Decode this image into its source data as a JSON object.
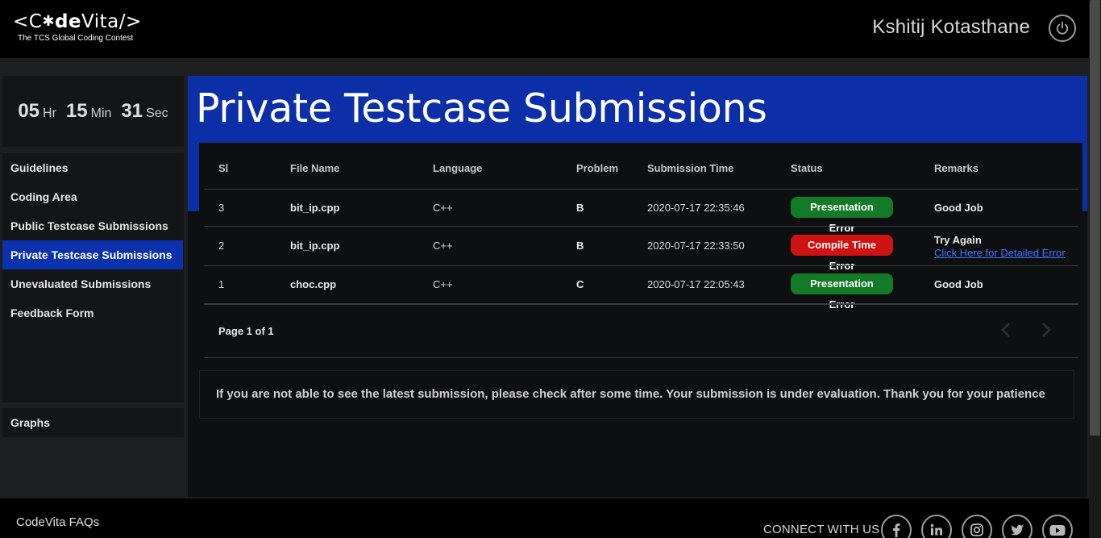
{
  "header": {
    "logo_prefix": "<C",
    "logo_star": "✱",
    "logo_de": "de",
    "logo_suffix": "Vita/>",
    "logo_tagline": "The TCS Global Coding Contest",
    "user_name": "Kshitij Kotasthane",
    "power_icon": "power-icon"
  },
  "timer": {
    "hours": "05",
    "hours_unit": "Hr",
    "minutes": "15",
    "minutes_unit": "Min",
    "seconds": "31",
    "seconds_unit": "Sec"
  },
  "sidebar": {
    "items": [
      {
        "label": "Guidelines"
      },
      {
        "label": "Coding Area"
      },
      {
        "label": "Public Testcase Submissions"
      },
      {
        "label": "Private Testcase Submissions",
        "active": true
      },
      {
        "label": "Unevaluated Submissions"
      },
      {
        "label": "Feedback Form"
      }
    ],
    "graphs_label": "Graphs"
  },
  "main": {
    "title": "Private Testcase Submissions",
    "columns": [
      "Sl",
      "File Name",
      "Language",
      "Problem",
      "Submission Time",
      "Status",
      "Remarks"
    ],
    "rows": [
      {
        "sl": "3",
        "file": "bit_ip.cpp",
        "language": "C++",
        "problem": "B",
        "time": "2020-07-17 22:35:46",
        "status": "Presentation Error",
        "status_color": "#137a27",
        "remarks": "Good Job"
      },
      {
        "sl": "2",
        "file": "bit_ip.cpp",
        "language": "C++",
        "problem": "B",
        "time": "2020-07-17 22:33:50",
        "status": "Compile Time Error",
        "status_color": "#cf1212",
        "remarks": "Try Again",
        "remarks_link": "Click Here for Detailed Error"
      },
      {
        "sl": "1",
        "file": "choc.cpp",
        "language": "C++",
        "problem": "C",
        "time": "2020-07-17 22:05:43",
        "status": "Presentation Error",
        "status_color": "#137a27",
        "remarks": "Good Job"
      }
    ],
    "pager": "Page 1 of 1",
    "notice": "If you are not able to see the latest submission, please check after some time. Your submission is under evaluation. Thank you for your patience"
  },
  "footer": {
    "faq": "CodeVita FAQs",
    "connect": "CONNECT WITH US",
    "social_icons": [
      "facebook-icon",
      "linkedin-icon",
      "instagram-icon",
      "twitter-icon",
      "youtube-icon"
    ]
  },
  "colors": {
    "accent_blue": "#0c2fa8",
    "success_green": "#137a27",
    "error_red": "#cf1212",
    "link_blue": "#3d76ff"
  }
}
